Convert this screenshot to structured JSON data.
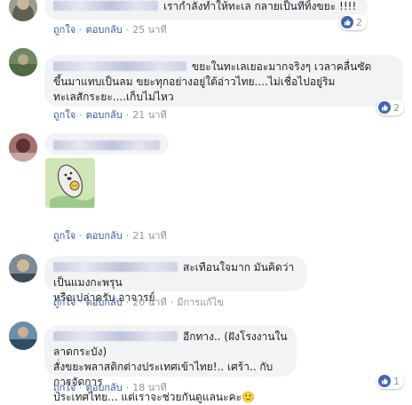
{
  "actions": {
    "like": "ถูกใจ",
    "reply": "ตอบกลับ",
    "separator": "·",
    "edited": "มีการแก้ไข"
  },
  "comments": [
    {
      "text": "เรากำลังทำให้ทะเล กลายเป็นที่ทิ้งขยะ !!!!",
      "time": "25 นาที",
      "reactions": "2"
    },
    {
      "line1": "ขยะในทะเลเยอะมากจริงๆ เวลาคลื่นซัด",
      "line2": "ขึ้นมาแทบเป็นลม ขยะทุกอย่างอยู่ใต้อ่าวไทย....ไม่เชื่อไปอยู่ริม",
      "line3": "ทะเลสักระยะ....เก็บไม่ไหว",
      "time": "21 นาที",
      "reactions": "2"
    },
    {
      "sticker": "sticker-seal",
      "time": "21 นาที"
    },
    {
      "line1": "สะเทือนใจมาก มันคิดว่าเป็นแมงกะพรุน",
      "line2": "หรือเปล่าครับ อาจารย์",
      "time": "20 นาที"
    },
    {
      "name_partial": "Phatch...Poch...",
      "line1": "อีกทาง.. (ฝังโรงงานในลาดกระบัง)",
      "line2": "สั่งขยะพลาสติกต่างประเทศเข้าไทย!.. เศร้า.. กับการจัดการ",
      "line3": "ประเทศไทย... แต่เราจะช่วยกันดูแลนะคะ",
      "emoji": "🙂",
      "time": "18 นาที",
      "reactions": "1"
    }
  ]
}
